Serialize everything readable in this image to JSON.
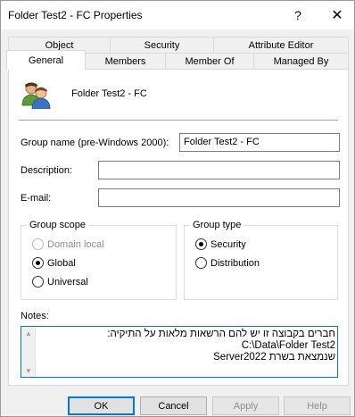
{
  "window": {
    "title": "Folder Test2 - FC Properties",
    "help_glyph": "?",
    "close_glyph": "✕"
  },
  "tabs": {
    "row_back": [
      "Object",
      "Security",
      "Attribute Editor"
    ],
    "row_front": [
      "General",
      "Members",
      "Member Of",
      "Managed By"
    ],
    "active": "General"
  },
  "general": {
    "object_name": "Folder Test2 - FC",
    "group_name_label": "Group name (pre-Windows 2000):",
    "group_name_value": "Folder Test2 - FC",
    "description_label": "Description:",
    "description_value": "",
    "email_label": "E-mail:",
    "email_value": "",
    "group_scope": {
      "title": "Group scope",
      "options": [
        "Domain local",
        "Global",
        "Universal"
      ],
      "selected": "Global",
      "disabled": [
        "Domain local"
      ]
    },
    "group_type": {
      "title": "Group type",
      "options": [
        "Security",
        "Distribution"
      ],
      "selected": "Security"
    },
    "notes_label": "Notes:",
    "notes_lines": [
      "חברים בקבוצה זו יש להם הרשאות מלאות על התיקיה:",
      "C:\\Data\\Folder Test2",
      "שנמצאת בשרת Server2022"
    ]
  },
  "buttons": {
    "ok": "OK",
    "cancel": "Cancel",
    "apply": "Apply",
    "help": "Help"
  }
}
